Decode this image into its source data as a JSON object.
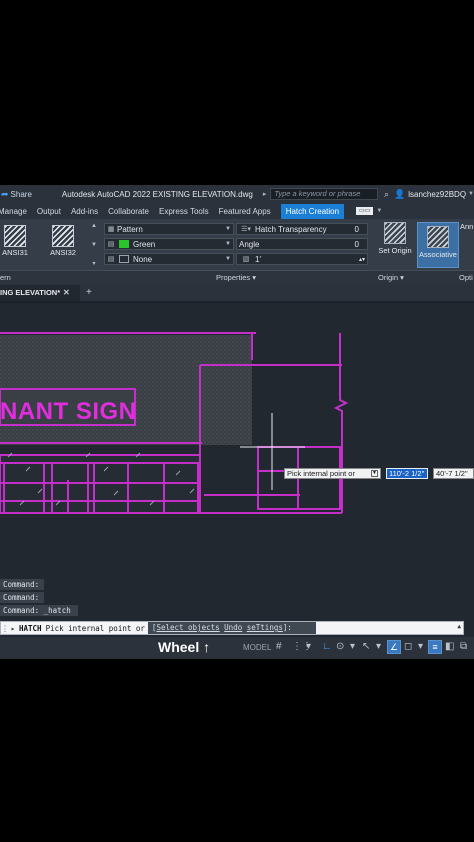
{
  "title_bar": {
    "share_label": "Share",
    "app_title": "Autodesk AutoCAD 2022   EXISTING ELEVATION.dwg",
    "search_placeholder": "Type a keyword or phrase",
    "user": "lsanchez92BDQ"
  },
  "ribbon_tabs": [
    {
      "label": "Manage"
    },
    {
      "label": "Output"
    },
    {
      "label": "Add-ins"
    },
    {
      "label": "Collaborate"
    },
    {
      "label": "Express Tools"
    },
    {
      "label": "Featured Apps"
    },
    {
      "label": "Hatch Creation",
      "active": true
    }
  ],
  "ribbon": {
    "patterns": [
      {
        "label": "ANSI31"
      },
      {
        "label": "ANSI32"
      }
    ],
    "properties": {
      "type": "Pattern",
      "color": "Green",
      "color_hex": "#2ac52a",
      "background": "None",
      "transparency_label": "Hatch Transparency",
      "transparency_value": "0",
      "angle_label": "Angle",
      "angle_value": "0",
      "scale_value": "1'"
    },
    "set_origin": "Set Origin",
    "associative": "Associative",
    "annotative_partial": "Ann",
    "sections": {
      "pattern_partial": "ern",
      "properties": "Properties ▾",
      "origin": "Origin ▾",
      "options_partial": "Opti"
    }
  },
  "file_tab": {
    "label": "ING ELEVATION*"
  },
  "drawing": {
    "sign_text": "NANT SIGN",
    "sign_color": "#e22ddf",
    "line_color": "#c52fc9",
    "tooltip": "Pick internal point or",
    "dyn_input_1": "110'-2 1/2\"",
    "dyn_input_2": "40'-7 1/2\""
  },
  "command_history": [
    "Command:",
    "Command:",
    "Command: _hatch"
  ],
  "command_line": {
    "command": "HATCH",
    "prompt": "Pick internal point or",
    "options_open": "[",
    "opt_select": "Select objects",
    "opt_undo": "Undo",
    "opt_settings": "seTtings",
    "options_close": "]:"
  },
  "status_bar": {
    "caption": "Wheel ↑",
    "model": "MODEL"
  }
}
